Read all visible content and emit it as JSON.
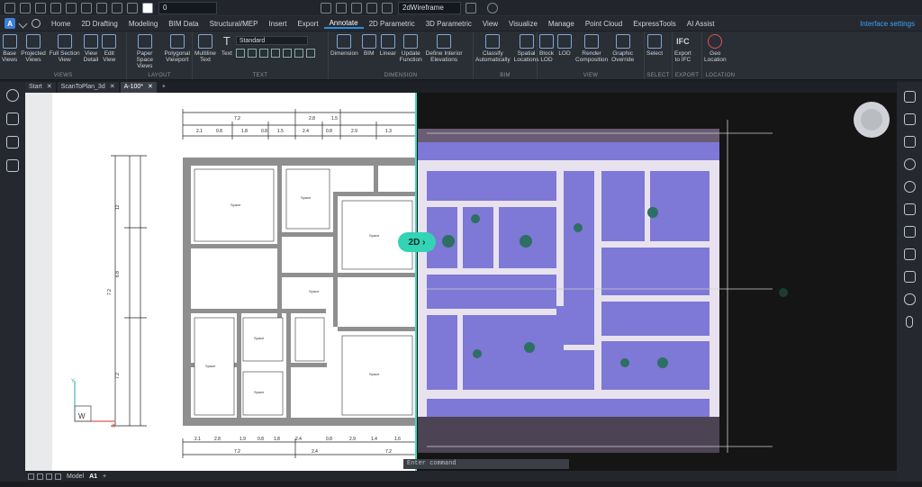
{
  "qat": {
    "layer_value": "0",
    "visual_style": "2dWireframe"
  },
  "menu": {
    "logo": "A",
    "tabs": [
      "Home",
      "2D Drafting",
      "Modeling",
      "BIM Data",
      "Structural/MEP",
      "Insert",
      "Export",
      "Annotate",
      "2D Parametric",
      "3D Parametric",
      "View",
      "Visualize",
      "Manage",
      "Point Cloud",
      "ExpressTools",
      "AI Assist"
    ],
    "active_tab": "Annotate",
    "interface_settings": "Interface settings"
  },
  "ribbon": {
    "views": {
      "name": "VIEWS",
      "buttons": [
        "Base\nViews",
        "Projected\nViews",
        "Full Section\nView",
        "View\nDetail",
        "Edit\nView"
      ]
    },
    "layout": {
      "name": "LAYOUT",
      "buttons": [
        "Paper Space\nViews",
        "Polygonal\nViewport"
      ]
    },
    "text": {
      "name": "TEXT",
      "buttons": [
        "Multiline\nText",
        "Text"
      ],
      "style_value": "Standard"
    },
    "dimension": {
      "name": "DIMENSION",
      "buttons": [
        "Dimension",
        "BIM",
        "Linear",
        "Update\nFunction",
        "Define Interior\nElevations"
      ]
    },
    "bim": {
      "name": "BIM",
      "buttons": [
        "Classify\nAutomatically",
        "Spatial\nLocations"
      ]
    },
    "view": {
      "name": "VIEW",
      "buttons": [
        "Block\nLOD",
        "LOD",
        "Render\nComposition",
        "Graphic\nOverride"
      ]
    },
    "select": {
      "name": "SELECT",
      "buttons": [
        "Select"
      ]
    },
    "export": {
      "name": "EXPORT",
      "buttons": [
        "Export\nto IFC"
      ],
      "ifc_label": "IFC"
    },
    "location": {
      "name": "LOCATION",
      "buttons": [
        "Geo\nLocation"
      ]
    }
  },
  "doc_tabs": [
    {
      "label": "Start",
      "active": false
    },
    {
      "label": "ScanToPlan_3d",
      "active": false
    },
    {
      "label": "A-100*",
      "active": true
    }
  ],
  "plus": "+",
  "viewport": {
    "badge": "2D ›",
    "command_prompt": "Enter command"
  },
  "drawing": {
    "room_label": "Space",
    "dims_top_row1": [
      "7.2",
      "2.8",
      "1.5"
    ],
    "dims_top_row2": [
      "2.1",
      "0.8",
      "1.8",
      "0.8",
      "1.5",
      "2.4",
      "0.8",
      "2.9",
      "1.3"
    ],
    "dims_left": [
      "12",
      "7.2",
      "6.8",
      "7.2"
    ],
    "dims_bottom_row1": [
      "2.1",
      "2.8",
      "1.9",
      "0.8",
      "1.8",
      "2.4",
      "0.8",
      "2.9",
      "1.4",
      "1.6"
    ],
    "dims_bottom_row2": [
      "7.2",
      "2.4",
      "7.2"
    ],
    "ucs_x": "X",
    "ucs_y": "Y",
    "ucs_w": "W"
  },
  "status": {
    "layouts": [
      "Model",
      "A1"
    ],
    "active_layout": "A1",
    "plus": "+"
  }
}
